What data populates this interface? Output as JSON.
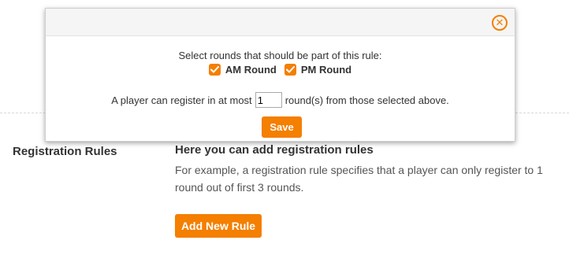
{
  "page": {
    "section_title": "Registration Rules",
    "section_heading": "Here you can add registration rules",
    "section_description": "For example, a registration rule specifies that a player can only register to 1 round out of first 3 rounds.",
    "add_rule_label": "Add New Rule"
  },
  "modal": {
    "close_icon": "close-x-circle-icon",
    "prompt": "Select rounds that should be part of this rule:",
    "rounds": [
      {
        "label": "AM Round",
        "checked": true
      },
      {
        "label": "PM Round",
        "checked": true
      }
    ],
    "limit_prefix": "A player can register in at most",
    "limit_value": "1",
    "limit_suffix": "round(s) from those selected above.",
    "save_label": "Save"
  },
  "colors": {
    "accent": "#f47f00",
    "text": "#333333",
    "header_bg": "#f5f5f5"
  }
}
